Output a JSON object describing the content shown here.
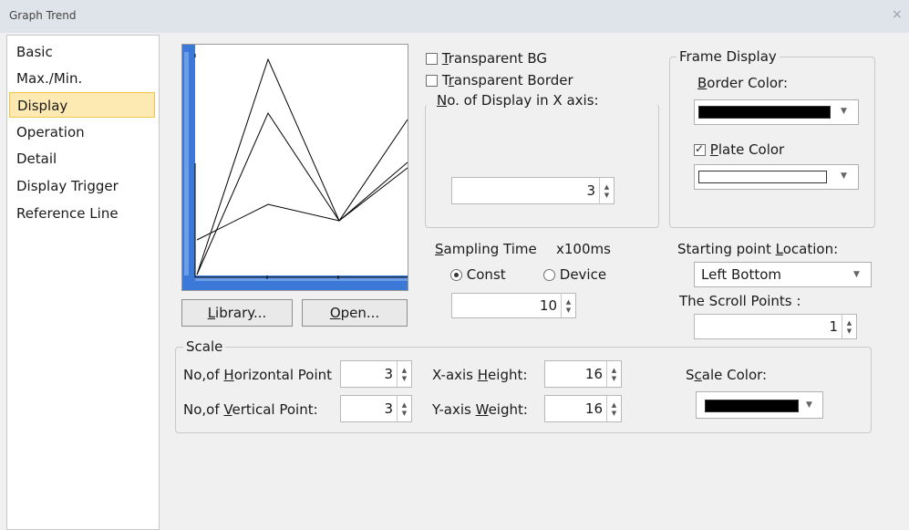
{
  "window": {
    "title": "Graph Trend",
    "close_icon": "×"
  },
  "sidebar": {
    "items": [
      {
        "label": "Basic"
      },
      {
        "label": "Max./Min."
      },
      {
        "label": "Display",
        "selected": true
      },
      {
        "label": "Operation"
      },
      {
        "label": "Detail"
      },
      {
        "label": "Display Trigger"
      },
      {
        "label": "Reference Line"
      }
    ]
  },
  "preview": {
    "library_button": {
      "pre": "",
      "u": "L",
      "post": "ibrary..."
    },
    "open_button": {
      "pre": "",
      "u": "O",
      "post": "pen..."
    }
  },
  "display": {
    "transparent_bg": {
      "pre": "",
      "u": "T",
      "post": "ransparent BG",
      "checked": false
    },
    "transparent_border": {
      "pre": "T",
      "u": "r",
      "post": "ansparent Border",
      "checked": false
    },
    "x_axis_count": {
      "pre": "",
      "u": "N",
      "post": "o. of Display in X axis:",
      "value": "3"
    }
  },
  "frame_display": {
    "legend": "Frame Display",
    "border_color": {
      "pre": "",
      "u": "B",
      "post": "order Color:",
      "color": "#000000"
    },
    "plate_color": {
      "pre": "",
      "u": "P",
      "post": "late Color",
      "checked": true,
      "color": "#ffffff"
    }
  },
  "sampling": {
    "label": {
      "pre": "",
      "u": "S",
      "post": "ampling Time"
    },
    "unit": "x100ms",
    "options": [
      {
        "label": "Const",
        "selected": true
      },
      {
        "label": "Device",
        "selected": false
      }
    ],
    "value": "10"
  },
  "starting_point": {
    "label": {
      "pre": "Starting point ",
      "u": "L",
      "post": "ocation:"
    },
    "value": "Left Bottom"
  },
  "scroll_points": {
    "label": "The Scroll Points :",
    "value": "1"
  },
  "scale": {
    "legend": "Scale",
    "horizontal": {
      "pre": "No,of ",
      "u": "H",
      "post": "orizontal Point",
      "value": "3"
    },
    "vertical": {
      "pre": "No,of ",
      "u": "V",
      "post": "ertical Point:",
      "value": "3"
    },
    "x_height": {
      "pre": "X-axis ",
      "u": "H",
      "post": "eight:",
      "value": "16"
    },
    "y_weight": {
      "pre": "Y-axis ",
      "u": "W",
      "post": "eight:",
      "value": "16"
    },
    "scale_color": {
      "pre": "S",
      "u": "c",
      "post": "ale Color:",
      "color": "#000000"
    }
  },
  "colors": {
    "accent_blue": "#3c78d8",
    "selection": "#fdeab2"
  }
}
